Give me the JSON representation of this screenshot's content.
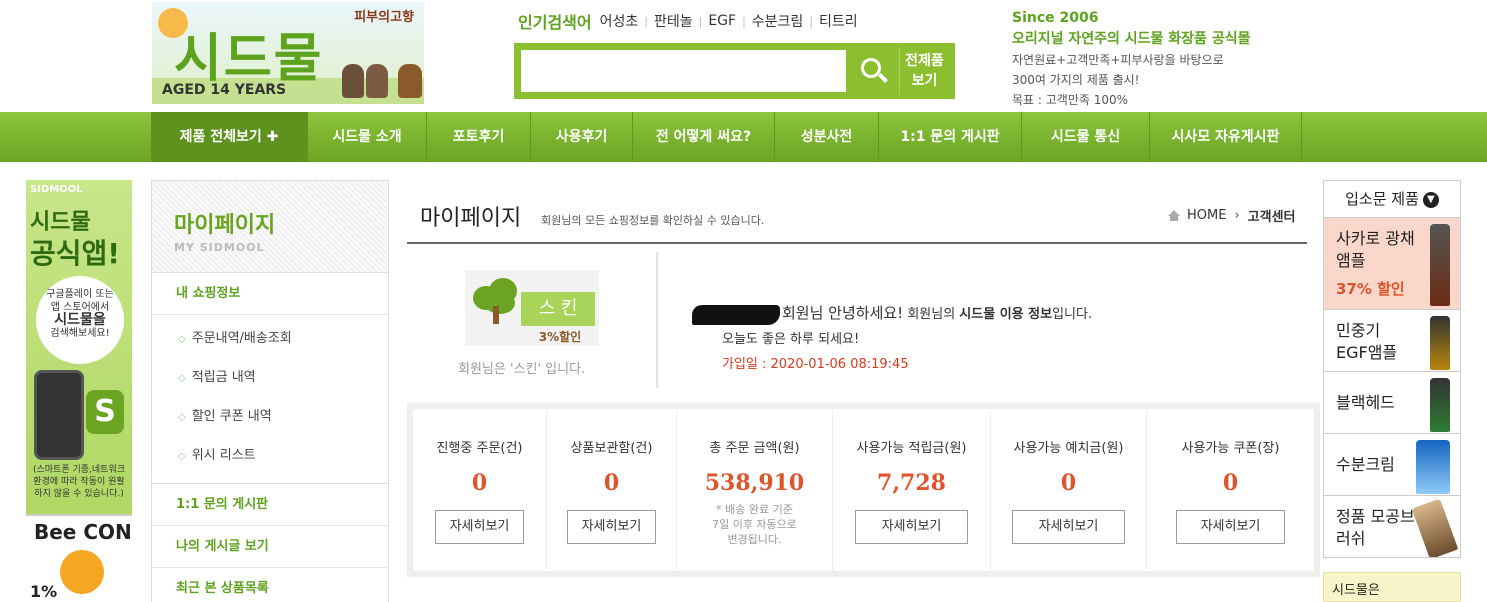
{
  "header": {
    "logo_text": "시드물",
    "logo_tagline": "피부의고향",
    "logo_aged": "AGED 14 YEARS",
    "popular_label": "인기검색어",
    "popular_keywords": [
      "어성초",
      "판테놀",
      "EGF",
      "수분크림",
      "티트리"
    ],
    "search_placeholder": "",
    "all_products_button": [
      "전제품",
      "보기"
    ],
    "since": "Since 2006",
    "slogan": "오리지널 자연주의 시드물 화장품 공식몰",
    "info_lines": [
      "자연원료+고객만족+피부사랑을 바탕으로",
      "300여 가지의 제품 출시!",
      "목표 : 고객만족 100%"
    ]
  },
  "nav": {
    "items": [
      "제품 전체보기 ✚",
      "시드물 소개",
      "포토후기",
      "사용후기",
      "전 어떻게 써요?",
      "성분사전",
      "1:1 문의 게시판",
      "시드물 통신",
      "시사모 자유게시판"
    ]
  },
  "ad_left": {
    "brand": "SIDMOOL",
    "line1": "시드물",
    "line2": "공식앱!",
    "bubble": [
      "구글플레이 또는",
      "앱 스토어에서",
      "시드물을",
      "검색해보세요!"
    ],
    "badge": "S",
    "note": [
      "(스마트폰 기종,네트워크",
      "환경에 따라 작동이 원활",
      "하지 않을 수 있습니다.)"
    ],
    "bee_title": "Bee CON",
    "bee_pct": "1%"
  },
  "sidebar": {
    "title": "마이페이지",
    "subtitle": "MY SIDMOOL",
    "section1": "내 쇼핑정보",
    "sub_items": [
      "주문내역/배송조회",
      "적립금 내역",
      "할인 쿠폰 내역",
      "위시 리스트"
    ],
    "section2": "1:1 문의 게시판",
    "section3": "나의 게시글 보기",
    "section4": "최근 본 상품목록"
  },
  "main": {
    "title": "마이페이지",
    "subtitle": "회원님의 모든 쇼핑정보를 확인하실 수 있습니다.",
    "breadcrumb_home": "HOME",
    "breadcrumb_current": "고객센터",
    "grade_label": "스 킨",
    "grade_discount": "3%할인",
    "grade_text": "회원님은 '스킨' 입니다.",
    "hello_name": "회원님 안녕하세요!",
    "hello_rest1": " 회원님의 ",
    "hello_bold": "시드물 이용 정보",
    "hello_rest2": "입니다.",
    "hello_line2": "오늘도 좋은 하루 되세요!",
    "join_date": "가입일 : 2020-01-06 08:19:45"
  },
  "stats": [
    {
      "label": "진행중 주문(건)",
      "value": "0",
      "button": "자세히보기"
    },
    {
      "label": "상품보관함(건)",
      "value": "0",
      "button": "자세히보기"
    },
    {
      "label": "총 주문 금액(원)",
      "value": "538,910",
      "note": [
        "* 배송 완료 기준",
        "7일 이후 자동으로",
        "변경됩니다."
      ]
    },
    {
      "label": "사용가능 적립금(원)",
      "value": "7,728",
      "button": "자세히보기"
    },
    {
      "label": "사용가능 예치금(원)",
      "value": "0",
      "button": "자세히보기"
    },
    {
      "label": "사용가능 쿠폰(장)",
      "value": "0",
      "button": "자세히보기"
    }
  ],
  "right": {
    "header": "입소문 제품",
    "products": [
      {
        "name": "사카로 광채앰플",
        "discount": "37% 할인"
      },
      {
        "name": "민중기 EGF앰플"
      },
      {
        "name": "블랙헤드"
      },
      {
        "name": "수분크림"
      },
      {
        "name": "정품 모공브러쉬"
      }
    ],
    "bottom": "시드물은"
  },
  "colors": {
    "brand_green": "#8cc63f",
    "accent_orange": "#e0542a",
    "join_red": "#d8391a"
  }
}
